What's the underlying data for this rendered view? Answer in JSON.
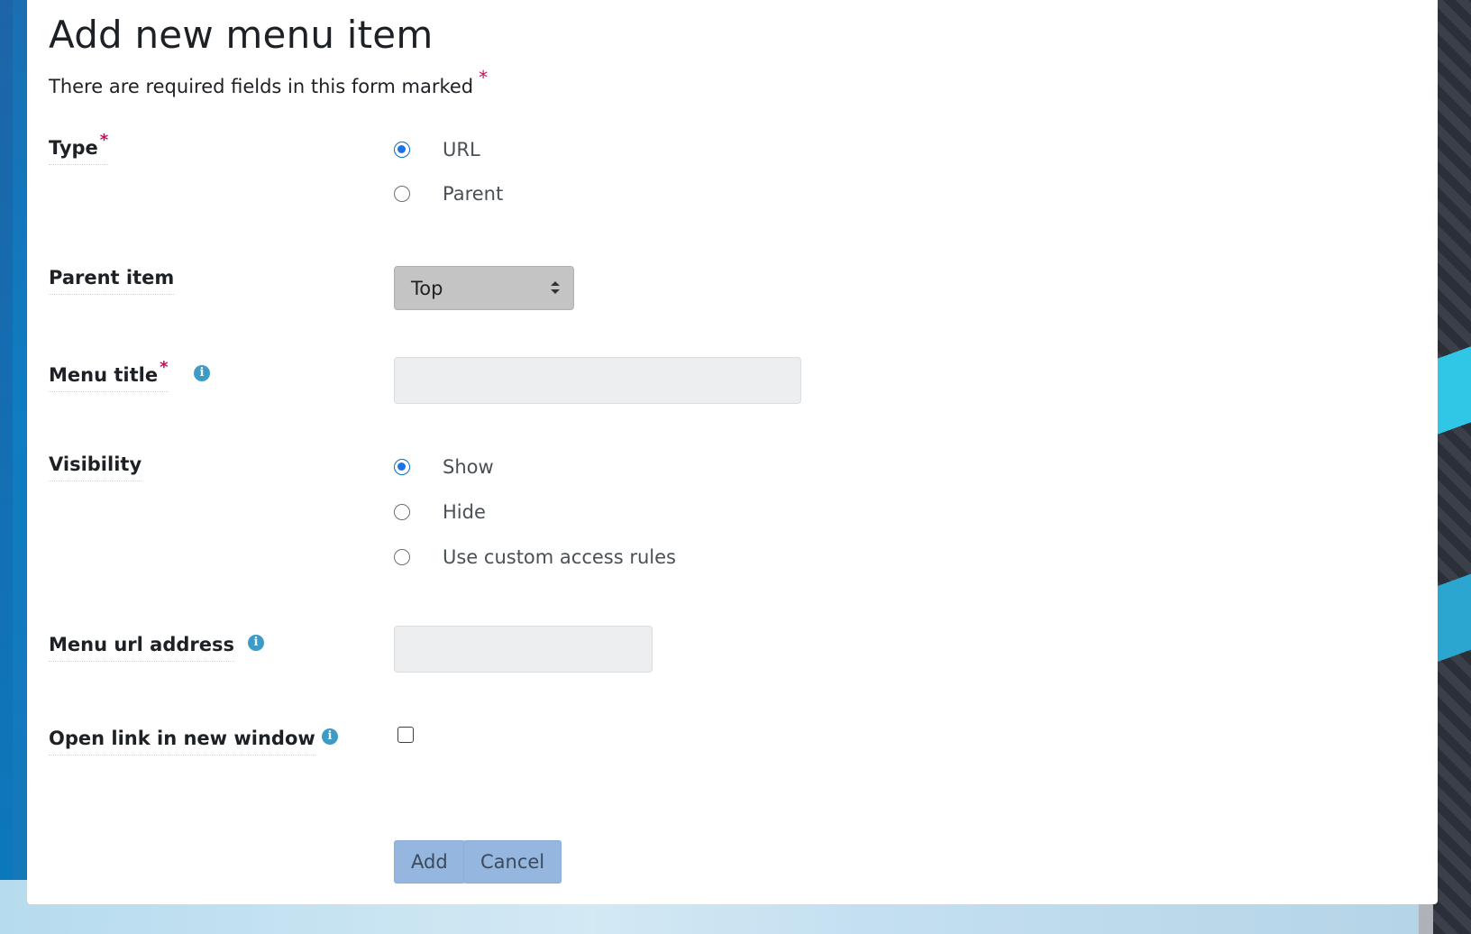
{
  "form": {
    "title": "Add new menu item",
    "required_note": "There are required fields in this form marked",
    "required_marker": "*",
    "fields": {
      "type": {
        "label": "Type",
        "options": [
          "URL",
          "Parent"
        ],
        "selected": "URL"
      },
      "parent_item": {
        "label": "Parent item",
        "selected": "Top"
      },
      "menu_title": {
        "label": "Menu title",
        "value": ""
      },
      "visibility": {
        "label": "Visibility",
        "options": [
          "Show",
          "Hide",
          "Use custom access rules"
        ],
        "selected": "Show"
      },
      "menu_url": {
        "label": "Menu url address",
        "value": ""
      },
      "open_new_window": {
        "label": "Open link in new window",
        "checked": false
      }
    },
    "buttons": {
      "add": "Add",
      "cancel": "Cancel"
    }
  },
  "colors": {
    "required_star": "#c4105a",
    "info_icon": "#3e9bc5",
    "radio_selected": "#1a73e8",
    "button_bg": "#95b6de"
  },
  "icons": {
    "info": "info-icon",
    "select_arrows": "sort-arrows-icon"
  }
}
